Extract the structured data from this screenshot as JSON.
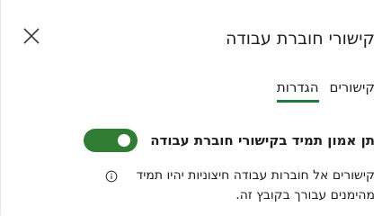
{
  "header": {
    "title": "קישורי חוברת עבודה",
    "close_icon": "close-icon"
  },
  "tabs": [
    {
      "label": "קישורים",
      "selected": false
    },
    {
      "label": "הגדרות",
      "selected": true
    }
  ],
  "settings": {
    "trust_toggle_label": "תן אמון תמיד בקישורי חוברת עבודה",
    "trust_toggle_on": true,
    "info_icon": "info-icon",
    "info_text": "קישורים אל חוברות עבודה חיצוניות יהיו תמיד מהימנים עבורך בקובץ זה."
  },
  "colors": {
    "accent": "#1e7b3c",
    "toggle_on": "#2e7d32"
  }
}
